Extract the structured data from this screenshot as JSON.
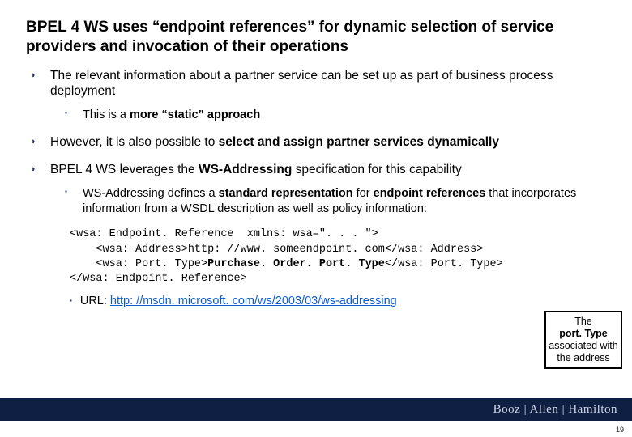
{
  "title": "BPEL 4 WS uses “endpoint references” for dynamic selection of service providers and invocation of their operations",
  "bullets": {
    "b1": {
      "text_pre": "The relevant information about a partner service can be set up as part of business process deployment",
      "sub1_pre": "This is a ",
      "sub1_bold": "more “static” approach"
    },
    "b2": {
      "pre": "However, it is also possible to ",
      "bold": "select and assign partner services dynamically"
    },
    "b3": {
      "pre": "BPEL 4 WS leverages the ",
      "bold": "WS-Addressing",
      "post": " specification for this capability",
      "sub1_a": "WS-Addressing defines a ",
      "sub1_b": "standard representation",
      "sub1_c": " for ",
      "sub1_d": "endpoint references",
      "sub1_e": " that incorporates information from a WSDL description as well as policy information:"
    }
  },
  "code": {
    "l1": "<wsa: Endpoint. Reference  xmlns: wsa=\". . . \">",
    "l2": "    <wsa: Address>http: //www. someendpoint. com</wsa: Address>",
    "l3a": "    <wsa: Port. Type>",
    "l3b": "Purchase. Order. Port. Type",
    "l3c": "</wsa: Port. Type>",
    "l4": "</wsa: Endpoint. Reference>"
  },
  "url_line": {
    "label": "URL: ",
    "href": "http: //msdn. microsoft. com/ws/2003/03/ws-addressing"
  },
  "callout": {
    "a": "The",
    "b": "port. Type",
    "c": "associated with the address"
  },
  "footer": {
    "brand": "Booz | Allen | Hamilton"
  },
  "page": "19"
}
